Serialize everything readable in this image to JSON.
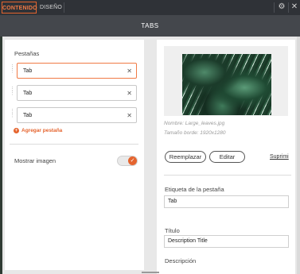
{
  "topbar": {
    "tabs": [
      {
        "label": "CONTENIDO",
        "active": true
      },
      {
        "label": "DISEÑO",
        "active": false
      }
    ],
    "icons": [
      "gear-icon",
      "close-icon"
    ]
  },
  "title": "TABS",
  "left": {
    "section_label": "Pestañas",
    "tabs": [
      {
        "label": "Tab",
        "focused": true
      },
      {
        "label": "Tab",
        "focused": false
      },
      {
        "label": "Tab",
        "focused": false
      }
    ],
    "add_label": "Agregar pestaña",
    "show_image_label": "Mostrar imagen",
    "show_image_enabled": true
  },
  "right": {
    "image_name": "Nombre: Large_leaves.jpg",
    "image_size": "Tamaño borde: 1920x1280",
    "replace_label": "Reemplazar",
    "edit_label": "Editar",
    "delete_label": "Suprimi",
    "tab_label_title": "Etiqueta de la pestaña",
    "tab_label_value": "Tab",
    "title_label": "Título",
    "title_value": "Description Title",
    "description_label": "Descripción"
  },
  "colors": {
    "accent": "#e5642e",
    "dark_bar": "#2f3237",
    "title_bar": "#44474c",
    "background": "#e8e8e8"
  }
}
